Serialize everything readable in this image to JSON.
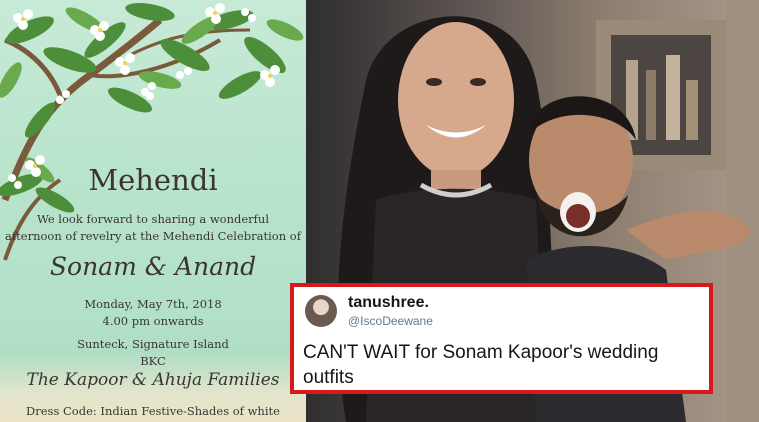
{
  "invitation": {
    "title": "Mehendi",
    "line1": "We look forward to sharing a wonderful",
    "line2": "afternoon of revelry at the Mehendi Celebration of",
    "names": "Sonam & Anand",
    "date": "Monday, May 7th, 2018",
    "time": "4.00 pm onwards",
    "venue": "Sunteck, Signature Island",
    "area": "BKC",
    "hosts": "The Kapoor & Ahuja Families",
    "dress_code": "Dress Code: Indian Festive-Shades of white"
  },
  "tweet": {
    "display_name": "tanushree.",
    "handle": "@IscoDeewane",
    "text": "CAN'T WAIT for Sonam Kapoor's wedding outfits",
    "border_color": "#d7191c"
  },
  "icons": {
    "tree": "frangipani-tree-illustration",
    "avatar": "profile-avatar",
    "photo": "couple-photo"
  }
}
